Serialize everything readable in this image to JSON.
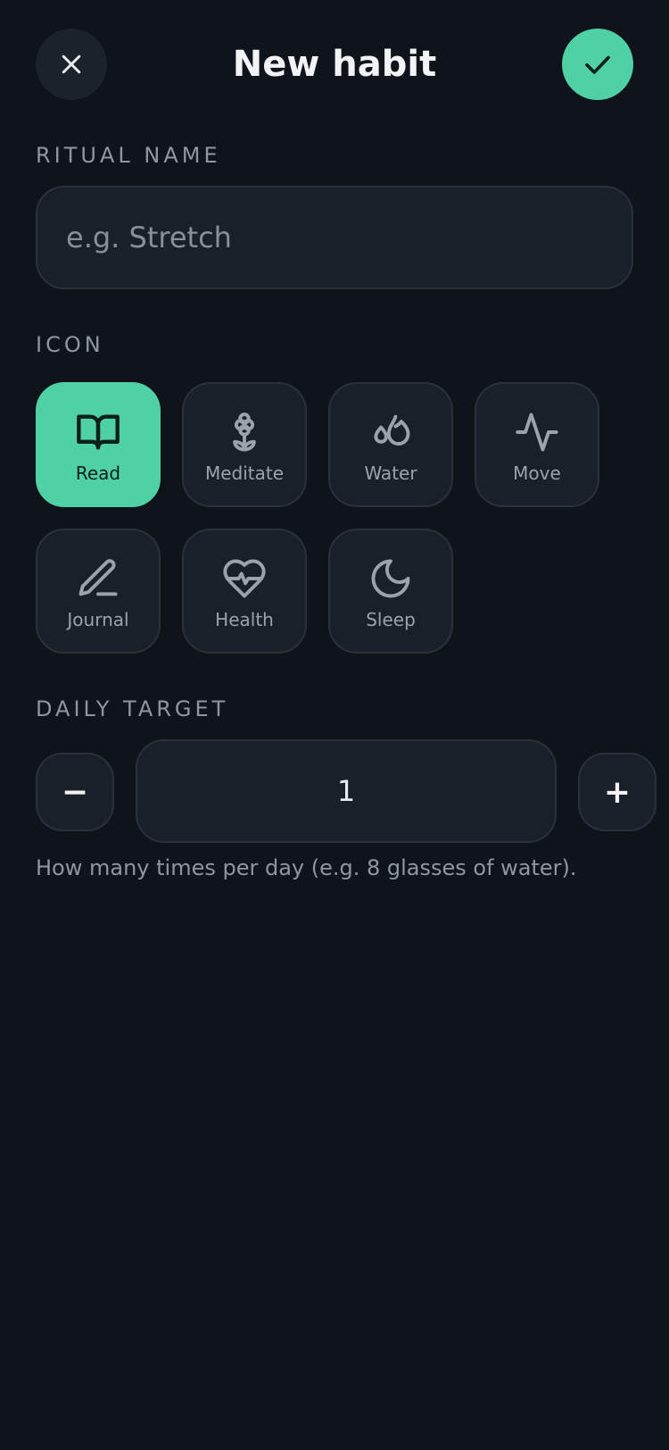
{
  "header": {
    "title": "New habit",
    "close_icon": "close-icon",
    "confirm_icon": "check-icon"
  },
  "ritual_name": {
    "label": "RITUAL NAME",
    "value": "",
    "placeholder": "e.g. Stretch"
  },
  "icon_section": {
    "label": "ICON",
    "selected": "Read",
    "options": [
      {
        "label": "Read",
        "icon": "book-icon"
      },
      {
        "label": "Meditate",
        "icon": "flower-icon"
      },
      {
        "label": "Water",
        "icon": "droplets-icon"
      },
      {
        "label": "Move",
        "icon": "activity-icon"
      },
      {
        "label": "Journal",
        "icon": "pen-icon"
      },
      {
        "label": "Health",
        "icon": "heart-pulse-icon"
      },
      {
        "label": "Sleep",
        "icon": "moon-icon"
      }
    ]
  },
  "daily_target": {
    "label": "DAILY TARGET",
    "value": "1",
    "decrement_label": "−",
    "increment_label": "+",
    "helper": "How many times per day (e.g. 8 glasses of water)."
  },
  "colors": {
    "background": "#0f131a",
    "accent": "#4fd1a5",
    "surface": "#1a2029",
    "muted_text": "#8e979f"
  }
}
